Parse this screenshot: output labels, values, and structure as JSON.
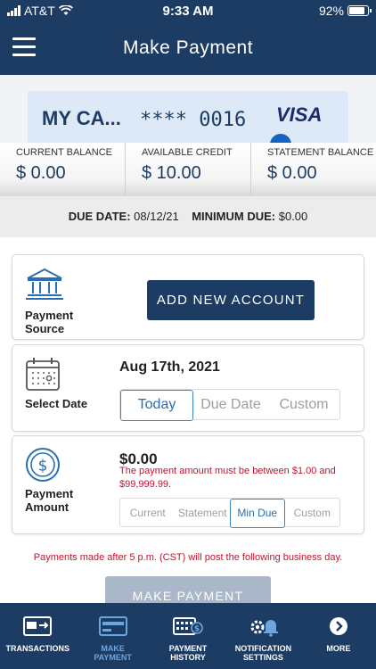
{
  "status": {
    "carrier": "AT&T",
    "time": "9:33 AM",
    "battery": "92%"
  },
  "header": {
    "title": "Make Payment"
  },
  "card": {
    "name": "MY CA...",
    "masked": "**** 0016",
    "brand": "VISA"
  },
  "balances": [
    {
      "label": "CURRENT BALANCE",
      "value": "$ 0.00"
    },
    {
      "label": "AVAILABLE CREDIT",
      "value": "$ 10.00"
    },
    {
      "label": "STATEMENT BALANCE",
      "value": "$ 0.00"
    }
  ],
  "due": {
    "due_label": "DUE DATE:",
    "due_value": "08/12/21",
    "min_label": "MINIMUM DUE:",
    "min_value": "$0.00"
  },
  "source": {
    "label_1": "Payment",
    "label_2": "Source",
    "add_button": "ADD NEW ACCOUNT"
  },
  "date": {
    "label": "Select Date",
    "selected": "Aug 17th, 2021",
    "options": [
      "Today",
      "Due Date",
      "Custom"
    ],
    "active": "Today"
  },
  "amount": {
    "label_1": "Payment",
    "label_2": "Amount",
    "value": "$0.00",
    "error": "The payment amount must be between $1.00 and $99,999.99.",
    "options": [
      "Current",
      "Statement",
      "Min Due",
      "Custom"
    ],
    "active": "Min Due"
  },
  "note": "Payments made after 5 p.m. (CST) will post the following business day.",
  "make_payment": "MAKE PAYMENT",
  "tabs": [
    {
      "line1": "TRANSACTIONS",
      "line2": ""
    },
    {
      "line1": "MAKE",
      "line2": "PAYMENT"
    },
    {
      "line1": "PAYMENT",
      "line2": "HISTORY"
    },
    {
      "line1": "NOTIFICATION",
      "line2": "SETTINGS"
    },
    {
      "line1": "MORE",
      "line2": ""
    }
  ],
  "colors": {
    "navy": "#1d3c64",
    "accent": "#3a86c8",
    "error": "#c8102e",
    "active_tab": "#6aa6e0"
  }
}
